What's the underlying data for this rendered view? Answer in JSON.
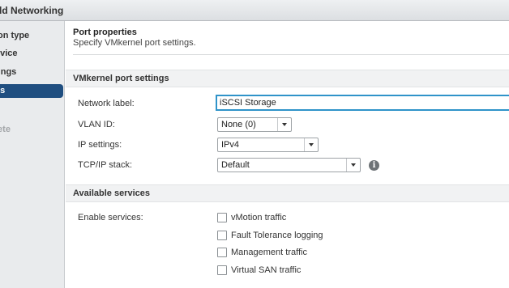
{
  "window": {
    "title": "dd Networking"
  },
  "sidebar": {
    "steps": [
      {
        "label": "ion type",
        "state": "normal"
      },
      {
        "label": "evice",
        "state": "normal"
      },
      {
        "label": "tings",
        "state": "normal"
      },
      {
        "label": "es",
        "state": "active"
      },
      {
        "label": "lete",
        "state": "disabled"
      }
    ]
  },
  "header": {
    "title": "Port properties",
    "subtitle": "Specify VMkernel port settings."
  },
  "sections": {
    "vmkernel": "VMkernel port settings",
    "services": "Available services"
  },
  "form": {
    "network_label": {
      "label": "Network label:",
      "value": "iSCSI Storage"
    },
    "vlan_id": {
      "label": "VLAN ID:",
      "value": "None (0)"
    },
    "ip_settings": {
      "label": "IP settings:",
      "value": "IPv4"
    },
    "tcpip_stack": {
      "label": "TCP/IP stack:",
      "value": "Default"
    }
  },
  "services": {
    "label": "Enable services:",
    "options": [
      {
        "label": "vMotion traffic",
        "checked": false
      },
      {
        "label": "Fault Tolerance logging",
        "checked": false
      },
      {
        "label": "Management traffic",
        "checked": false
      },
      {
        "label": "Virtual SAN traffic",
        "checked": false
      }
    ]
  },
  "colors": {
    "accent": "#2f93c9",
    "active_step": "#1f4e80"
  },
  "icons": {
    "info": "info-icon",
    "dropdown": "chevron-down-icon"
  }
}
